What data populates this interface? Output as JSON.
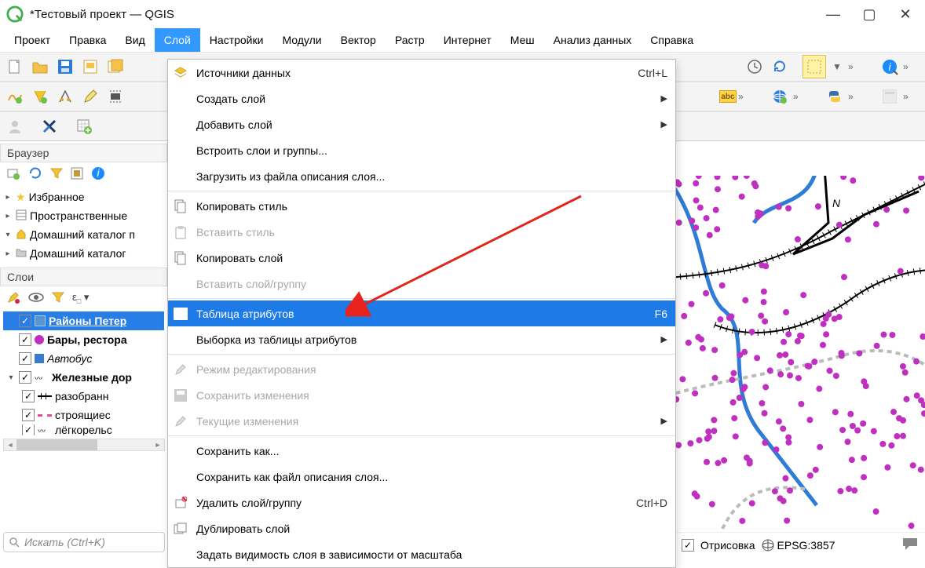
{
  "window": {
    "title": "*Тестовый проект — QGIS"
  },
  "menubar": [
    "Проект",
    "Правка",
    "Вид",
    "Слой",
    "Настройки",
    "Модули",
    "Вектор",
    "Растр",
    "Интернет",
    "Меш",
    "Анализ данных",
    "Справка"
  ],
  "menubar_active": 3,
  "dropdown": {
    "items": [
      {
        "label": "Источники данных",
        "shortcut": "Ctrl+L",
        "icon": "layers"
      },
      {
        "label": "Создать слой",
        "submenu": true
      },
      {
        "label": "Добавить слой",
        "submenu": true
      },
      {
        "label": "Встроить слои и группы..."
      },
      {
        "label": "Загрузить из файла описания слоя..."
      },
      {
        "sep": true
      },
      {
        "label": "Копировать стиль",
        "icon": "copy"
      },
      {
        "label": "Вставить стиль",
        "icon": "paste",
        "disabled": true
      },
      {
        "label": "Копировать слой",
        "icon": "copy"
      },
      {
        "label": "Вставить слой/группу",
        "disabled": true
      },
      {
        "sep": true
      },
      {
        "label": "Таблица атрибутов",
        "shortcut": "F6",
        "icon": "table",
        "highlight": true
      },
      {
        "label": "Выборка из таблицы атрибутов",
        "submenu": true
      },
      {
        "sep": true
      },
      {
        "label": "Режим редактирования",
        "icon": "pencil",
        "disabled": true
      },
      {
        "label": "Сохранить изменения",
        "icon": "save",
        "disabled": true
      },
      {
        "label": "Текущие изменения",
        "submenu": true,
        "icon": "pencil",
        "disabled": true
      },
      {
        "sep": true
      },
      {
        "label": "Сохранить как..."
      },
      {
        "label": "Сохранить как файл описания слоя..."
      },
      {
        "label": "Удалить слой/группу",
        "shortcut": "Ctrl+D",
        "icon": "remove"
      },
      {
        "label": "Дублировать слой",
        "icon": "duplicate"
      },
      {
        "label": "Задать видимость слоя в зависимости от масштаба"
      }
    ]
  },
  "browser": {
    "title": "Браузер",
    "items": [
      {
        "icon": "star",
        "label": "Избранное",
        "expander": "closed"
      },
      {
        "icon": "db",
        "label": "Пространственные",
        "expander": "closed"
      },
      {
        "icon": "home",
        "label": "Домашний каталог п",
        "expander": "open"
      },
      {
        "icon": "folder",
        "label": "Домашний каталог",
        "expander": "closed"
      }
    ]
  },
  "layers": {
    "title": "Слои",
    "items": [
      {
        "checked": true,
        "selected": true,
        "label": "Районы Петер",
        "swatch": "#7aa6c2",
        "bold": true,
        "underline": true
      },
      {
        "checked": true,
        "label": "Бары, рестора",
        "swatch": "#c030c0",
        "bold": true,
        "swtype": "dot"
      },
      {
        "checked": true,
        "label": "Автобус",
        "swatch": "#3a7acb",
        "italic": true,
        "swtype": "sq"
      },
      {
        "checked": true,
        "label": "Железные дор",
        "bold": true,
        "expander": "open",
        "swtype": "line"
      },
      {
        "checked": true,
        "label": "разобранн",
        "indent": 1,
        "swtype": "rail"
      },
      {
        "checked": true,
        "label": "строящиес",
        "indent": 1,
        "swtype": "dash",
        "swatch": "#e84a9a"
      },
      {
        "checked": true,
        "label": "лёгкорельс",
        "indent": 1,
        "swtype": "line",
        "cut": true
      }
    ]
  },
  "search": {
    "placeholder": "Искать (Ctrl+K)"
  },
  "status": {
    "render_label": "Отрисовка",
    "crs": "EPSG:3857"
  }
}
